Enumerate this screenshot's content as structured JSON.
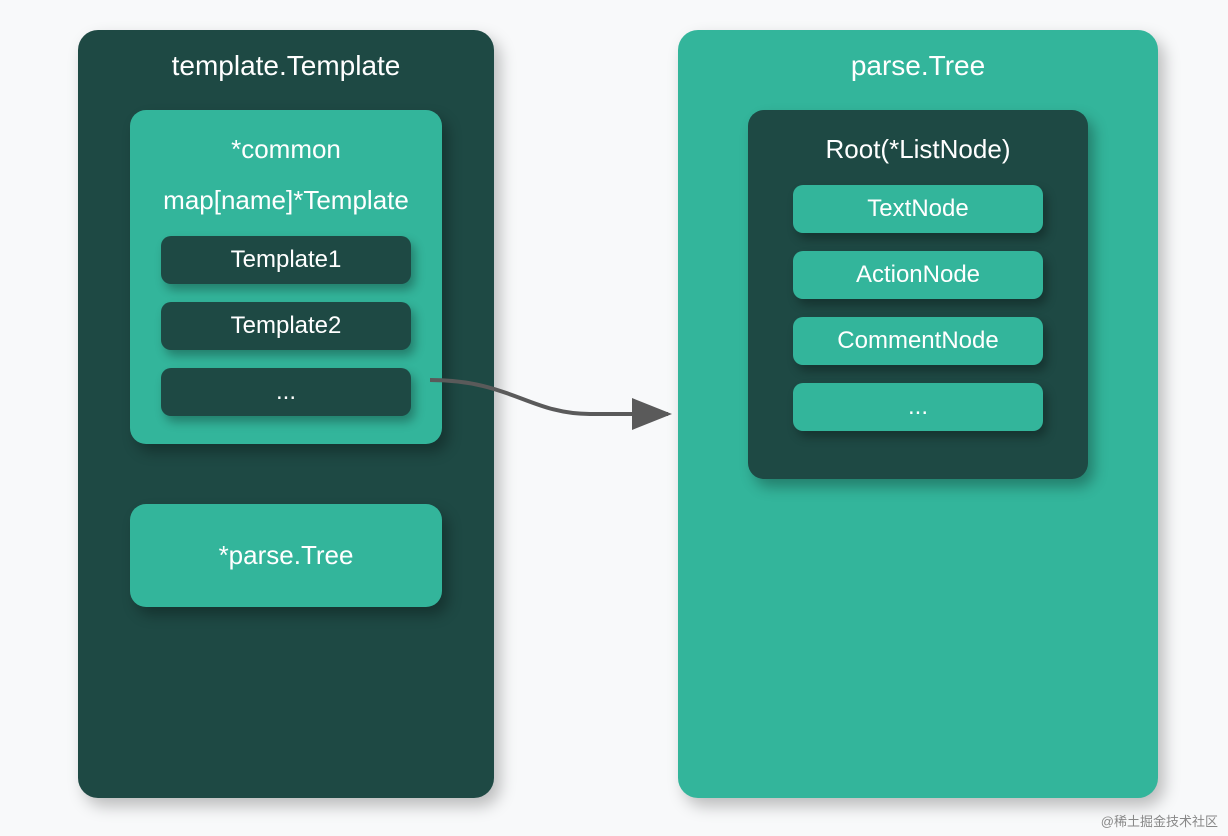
{
  "left": {
    "title": "template.Template",
    "common": {
      "title": "*common",
      "subtitle": "map[name]*Template",
      "items": [
        "Template1",
        "Template2",
        "..."
      ]
    },
    "parseTree": "*parse.Tree"
  },
  "right": {
    "title": "parse.Tree",
    "root": {
      "title": "Root(*ListNode)",
      "items": [
        "TextNode",
        "ActionNode",
        "CommentNode",
        "..."
      ]
    }
  },
  "watermark": "@稀土掘金技术社区"
}
